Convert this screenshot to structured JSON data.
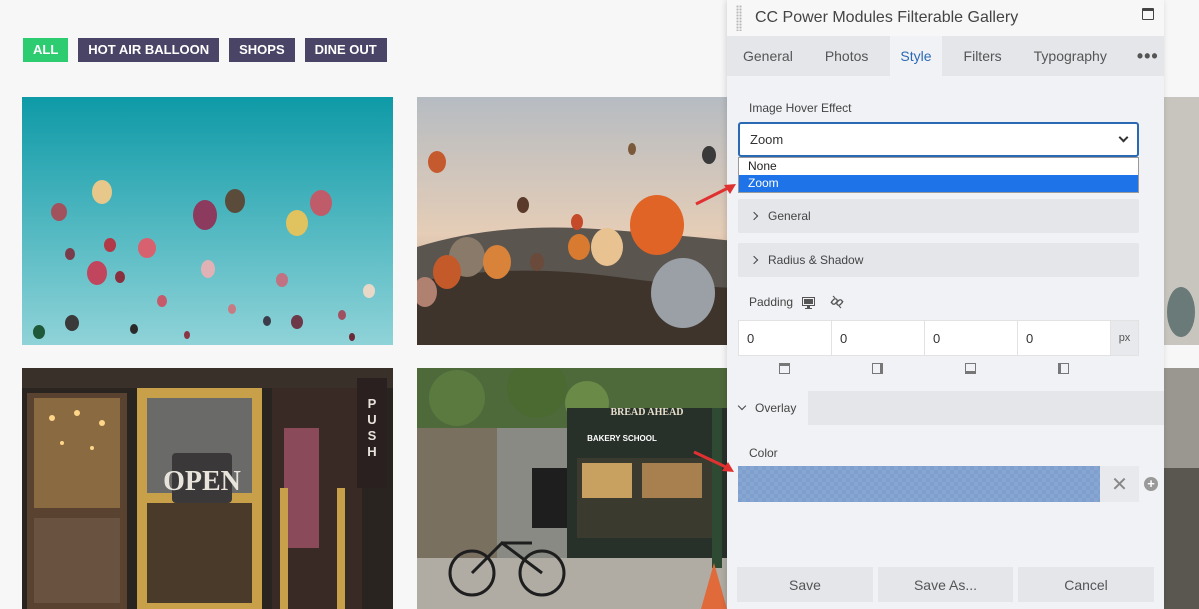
{
  "filters": [
    {
      "label": "ALL",
      "active": true
    },
    {
      "label": "HOT AIR BALLOON",
      "active": false
    },
    {
      "label": "SHOPS",
      "active": false
    },
    {
      "label": "DINE OUT",
      "active": false
    }
  ],
  "panel": {
    "title": "CC Power Modules Filterable Gallery",
    "tabs": [
      "General",
      "Photos",
      "Style",
      "Filters",
      "Typography"
    ],
    "active_tab": "Style",
    "more_label": "•••",
    "hover_effect": {
      "label": "Image Hover Effect",
      "value": "Zoom",
      "options": [
        "None",
        "Zoom"
      ]
    },
    "sections": {
      "general": "General",
      "radius_shadow": "Radius & Shadow"
    },
    "padding": {
      "label": "Padding",
      "values": [
        "0",
        "0",
        "0",
        "0"
      ],
      "unit": "px"
    },
    "overlay": {
      "tab_label": "Overlay",
      "color_label": "Color",
      "color_value": "#7fa0cf",
      "clear_symbol": "✕",
      "add_symbol": "+"
    },
    "footer": {
      "save": "Save",
      "save_as": "Save As...",
      "cancel": "Cancel"
    }
  },
  "colors": {
    "filter_active": "#2ecc71",
    "filter_default": "#4a4466",
    "accent": "#2a6ab5",
    "selected_option": "#1e73e8",
    "annotation_arrow": "#e03131"
  },
  "icons": [
    "drag-handle-icon",
    "minimize-icon",
    "chevron-down-icon",
    "desktop-icon",
    "unlink-icon",
    "close-icon",
    "plus-icon"
  ]
}
